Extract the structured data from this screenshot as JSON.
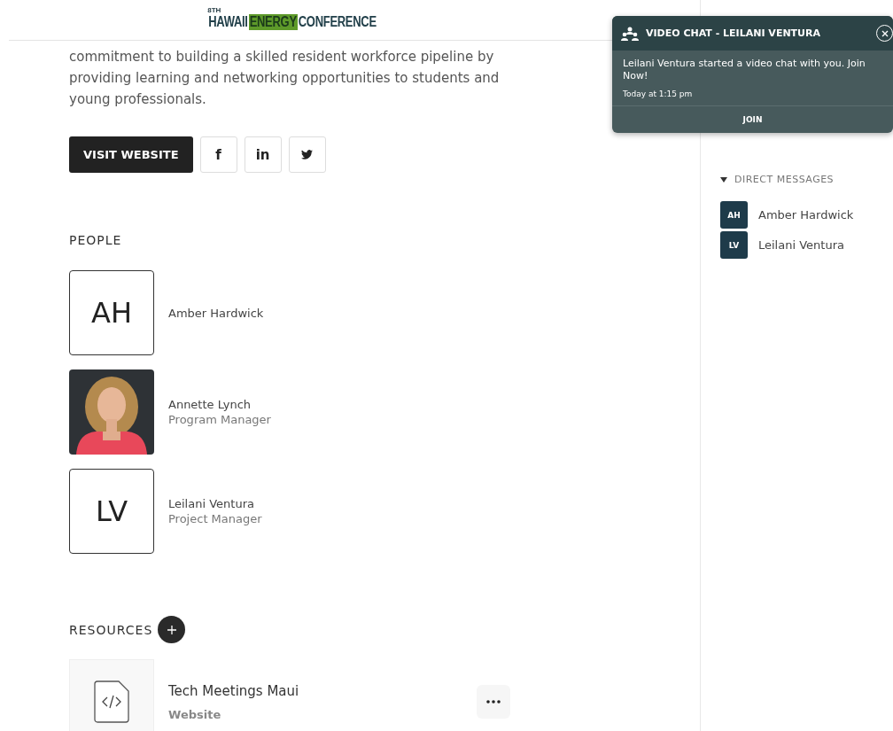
{
  "header": {
    "logo": {
      "edition": "8TH",
      "words": [
        {
          "text": "HAWAII",
          "highlight": false
        },
        {
          "text": "ENERGY",
          "highlight": true
        },
        {
          "text": "CONFERENCE",
          "highlight": false
        }
      ]
    }
  },
  "about": {
    "lines": [
      "commitment to building a skilled resident workforce pipeline by",
      "providing learning and networking opportunities to students and",
      "young professionals."
    ]
  },
  "actions": {
    "website_button": "VISIT WEBSITE",
    "social": [
      {
        "kind": "text",
        "label": "f"
      },
      {
        "kind": "text",
        "label": "in"
      },
      {
        "kind": "twitter"
      }
    ]
  },
  "people": {
    "heading": "PEOPLE",
    "items": [
      {
        "kind": "initials",
        "initials": "AH",
        "name": "Amber Hardwick"
      },
      {
        "kind": "picture",
        "name": "Annette Lynch",
        "role": "Program Manager"
      },
      {
        "kind": "initials",
        "initials": "LV",
        "name": "Leilani Ventura",
        "role": "Project Manager"
      }
    ]
  },
  "resources": {
    "heading": "RESOURCES",
    "items": [
      {
        "title": "Tech Meetings Maui",
        "type": "Website"
      }
    ]
  },
  "sidebar": {
    "section": "DIRECT MESSAGES",
    "expanded": true,
    "contacts": [
      {
        "initials": "AH",
        "name": "Amber Hardwick"
      },
      {
        "initials": "LV",
        "name": "Leilani Ventura"
      }
    ]
  },
  "toast": {
    "title": "VIDEO CHAT - LEILANI VENTURA",
    "message": "Leilani Ventura started a video chat with you. Join Now!",
    "time": "Today at 1:15 pm",
    "action": "JOIN"
  }
}
